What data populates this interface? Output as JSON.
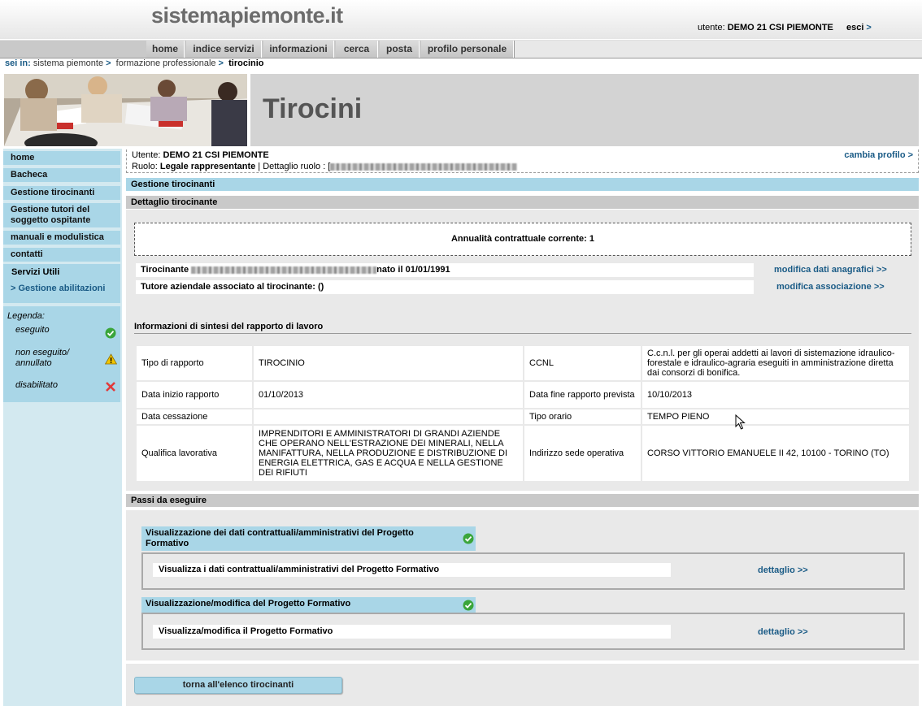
{
  "header": {
    "logo": "sistemapiemonte.it",
    "user_label": "utente:",
    "user_name": "DEMO 21 CSI PIEMONTE",
    "logout": "esci"
  },
  "topmenu": [
    {
      "label": "home"
    },
    {
      "label": "indice servizi"
    },
    {
      "label": "informazioni"
    },
    {
      "label": "cerca"
    },
    {
      "label": "posta"
    },
    {
      "label": "profilo personale"
    }
  ],
  "breadcrumb": {
    "prefix": "sei in:",
    "items": [
      "sistema piemonte",
      "formazione professionale"
    ],
    "current": "tirocinio"
  },
  "banner": {
    "title": "Tirocini"
  },
  "leftnav": {
    "items": [
      {
        "label": "home"
      },
      {
        "label": "Bacheca"
      },
      {
        "label": "Gestione tirocinanti"
      },
      {
        "label": "Gestione tutori del soggetto ospitante"
      },
      {
        "label": "manuali e modulistica"
      },
      {
        "label": "contatti"
      }
    ],
    "servizi_title": "Servizi Utili",
    "servizi_link": "Gestione abilitazioni"
  },
  "legend": {
    "title": "Legenda:",
    "done": "eseguito",
    "not_done": "non eseguito/ annullato",
    "disabled": "disabilitato"
  },
  "userinfo": {
    "utente_label": "Utente:",
    "utente": "DEMO 21 CSI PIEMONTE",
    "ruolo_label": "Ruolo:",
    "ruolo": "Legale rappresentante",
    "dettaglio_label": "| Dettaglio ruolo : [",
    "cambia": "cambia profilo"
  },
  "sections": {
    "gestione": "Gestione tirocinanti",
    "dettaglio": "Dettaglio tirocinante",
    "passi": "Passi da eseguire"
  },
  "annualita": {
    "label": "Annualità contrattuale corrente:",
    "value": "1"
  },
  "tirocinante": {
    "label": "Tirocinante",
    "nato": "nato il 01/01/1991",
    "tutore": "Tutore aziendale associato al tirocinante: ()",
    "link_anagrafici": "modifica dati anagrafici >>",
    "link_associazione": "modifica associazione >>"
  },
  "sintesi_title": "Informazioni di sintesi del rapporto di lavoro",
  "rapporto": {
    "tipo_label": "Tipo di rapporto",
    "tipo": "TIROCINIO",
    "ccnl_label": "CCNL",
    "ccnl": "C.c.n.l. per gli operai addetti ai lavori di sistemazione idraulico-forestale e idraulico-agraria eseguiti in amministrazione diretta dai consorzi di bonifica.",
    "inizio_label": "Data inizio rapporto",
    "inizio": "01/10/2013",
    "fine_label": "Data fine rapporto prevista",
    "fine": "10/10/2013",
    "cessazione_label": "Data cessazione",
    "cessazione": "",
    "orario_label": "Tipo orario",
    "orario": "TEMPO PIENO",
    "qualifica_label": "Qualifica lavorativa",
    "qualifica": "IMPRENDITORI E AMMINISTRATORI DI GRANDI AZIENDE CHE OPERANO NELL'ESTRAZIONE DEI MINERALI, NELLA MANIFATTURA, NELLA PRODUZIONE E DISTRIBUZIONE DI ENERGIA ELETTRICA, GAS E ACQUA E NELLA GESTIONE DEI RIFIUTI",
    "sede_label": "Indirizzo sede operativa",
    "sede": "CORSO VITTORIO EMANUELE II 42,  10100 -  TORINO  (TO)"
  },
  "steps": [
    {
      "title": "Visualizzazione dei dati contrattuali/amministrativi del Progetto Formativo",
      "item": "Visualizza i dati contrattuali/amministrativi del Progetto Formativo",
      "link": "dettaglio >>"
    },
    {
      "title": "Visualizzazione/modifica del Progetto Formativo",
      "item": "Visualizza/modifica il Progetto Formativo",
      "link": "dettaglio >>"
    }
  ],
  "back_button": "torna all'elenco tirocinanti",
  "colors": {
    "accent_blue": "#a9d6e7",
    "link": "#1a5b86",
    "ok_green": "#3aa53a"
  }
}
